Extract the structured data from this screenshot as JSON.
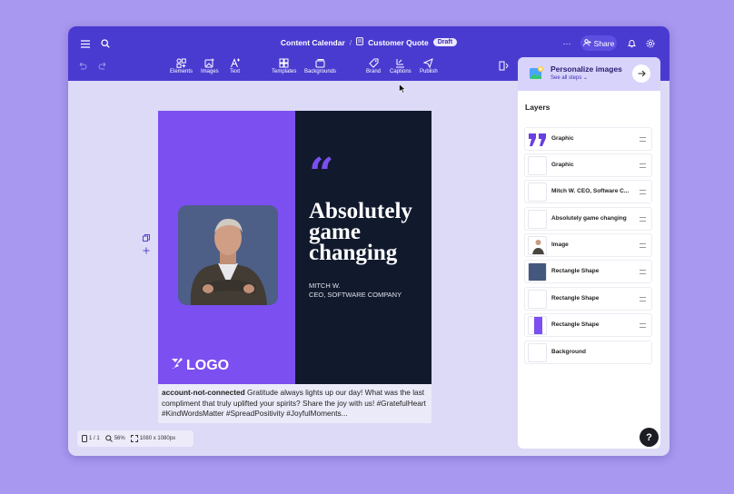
{
  "header": {
    "project": "Content Calendar",
    "separator": "/",
    "document": "Customer Quote",
    "status_badge": "Draft",
    "share_label": "Share",
    "more_label": "···"
  },
  "toolbar": {
    "undo_icon": "undo-icon",
    "redo_icon": "redo-icon",
    "items": [
      {
        "label": "Elements",
        "icon": "elements-icon"
      },
      {
        "label": "Images",
        "icon": "images-icon"
      },
      {
        "label": "Text",
        "icon": "text-icon"
      },
      {
        "label": "Templates",
        "icon": "templates-icon"
      },
      {
        "label": "Backgrounds",
        "icon": "backgrounds-icon"
      },
      {
        "label": "Brand",
        "icon": "brand-icon"
      },
      {
        "label": "Captions",
        "icon": "captions-icon"
      },
      {
        "label": "Publish",
        "icon": "publish-icon"
      }
    ]
  },
  "promo": {
    "title": "Personalize images",
    "subtitle": "See all steps ⌄"
  },
  "layers": {
    "title": "Layers",
    "items": [
      {
        "label": "Graphic"
      },
      {
        "label": "Graphic"
      },
      {
        "label": "Mitch W. CEO, Software C..."
      },
      {
        "label": "Absolutely game changing"
      },
      {
        "label": "Image"
      },
      {
        "label": "Rectangle Shape"
      },
      {
        "label": "Rectangle Shape"
      },
      {
        "label": "Rectangle Shape"
      },
      {
        "label": "Background"
      }
    ]
  },
  "design": {
    "quote_mark": "“",
    "headline": "Absolutely game changing",
    "author_name": "MITCH W.",
    "author_title": "CEO, SOFTWARE COMPANY",
    "logo_text": "LOGO",
    "colors": {
      "purple": "#7c4ff0",
      "navy": "#111a2d",
      "photo_bg": "#4d5f86"
    }
  },
  "caption": {
    "account": "account-not-connected",
    "text": "Gratitude always lights up our day! What was the last compliment that truly uplifted your spirits? Share the joy with us! #GratefulHeart #KindWordsMatter #SpreadPositivity #JoyfulMoments..."
  },
  "status": {
    "page": "1 / 1",
    "zoom": "56%",
    "size": "1080 x 1080px"
  },
  "help_label": "?"
}
